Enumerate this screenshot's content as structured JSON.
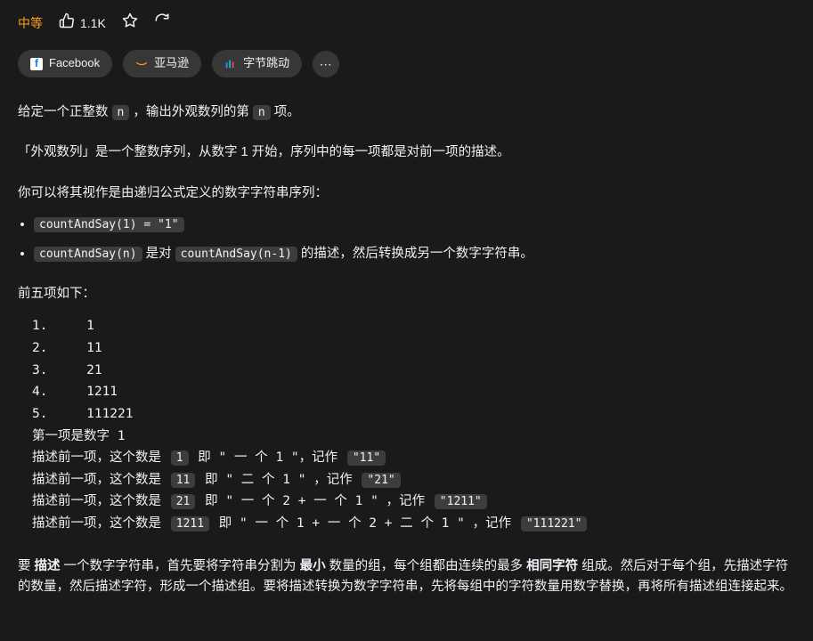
{
  "header": {
    "difficulty": "中等",
    "likes": "1.1K"
  },
  "tags": {
    "facebook": "Facebook",
    "amazon": "亚马逊",
    "bytedance": "字节跳动",
    "more": "⋯"
  },
  "para1": {
    "pre": "给定一个正整数 ",
    "code1": "n",
    "mid": " ，输出外观数列的第 ",
    "code2": "n",
    "post": " 项。"
  },
  "para2": "「外观数列」是一个整数序列，从数字 1 开始，序列中的每一项都是对前一项的描述。",
  "para3": "你可以将其视作是由递归公式定义的数字字符串序列：",
  "bullet1": {
    "code": "countAndSay(1) = \"1\""
  },
  "bullet2": {
    "code1": "countAndSay(n)",
    "mid": " 是对 ",
    "code2": "countAndSay(n-1)",
    "post": " 的描述，然后转换成另一个数字字符串。"
  },
  "para4": "前五项如下：",
  "block": {
    "l1": "1.     1",
    "l2": "2.     11",
    "l3": "3.     21",
    "l4": "4.     1211",
    "l5": "5.     111221",
    "l6": "第一项是数字 1",
    "d1": {
      "pre": "描述前一项，这个数是 ",
      "c1": "1",
      "mid": " 即 \" 一 个 1 \"，记作 ",
      "c2": "\"11\""
    },
    "d2": {
      "pre": "描述前一项，这个数是 ",
      "c1": "11",
      "mid": " 即 \" 二 个 1 \" ，记作 ",
      "c2": "\"21\""
    },
    "d3": {
      "pre": "描述前一项，这个数是 ",
      "c1": "21",
      "mid": " 即 \" 一 个 2 + 一 个 1 \" ，记作 ",
      "c2": "\"1211\""
    },
    "d4": {
      "pre": "描述前一项，这个数是 ",
      "c1": "1211",
      "mid": " 即 \" 一 个 1 + 一 个 2 + 二 个 1 \" ，记作 ",
      "c2": "\"111221\""
    }
  },
  "para5": {
    "t1": "要 ",
    "b1": "描述",
    "t2": " 一个数字字符串，首先要将字符串分割为 ",
    "b2": "最小",
    "t3": " 数量的组，每个组都由连续的最多 ",
    "b3": "相同字符",
    "t4": " 组成。然后对于每个组，先描述字符的数量，然后描述字符，形成一个描述组。要将描述转换为数字字符串，先将每组中的字符数量用数字替换，再将所有描述组连接起来。"
  }
}
